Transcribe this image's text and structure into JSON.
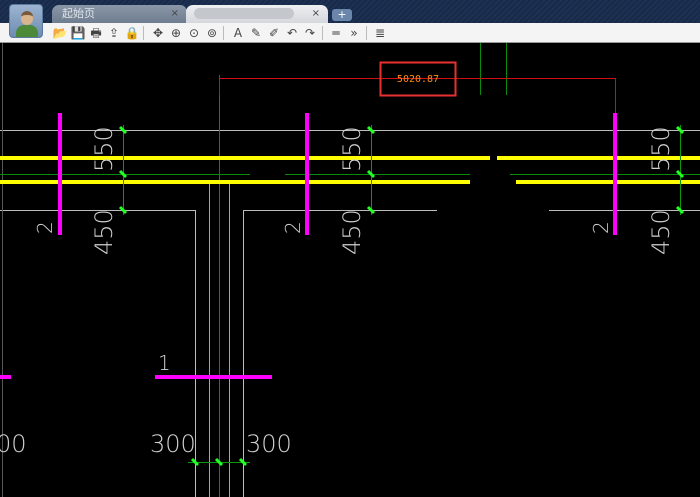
{
  "tabs": [
    {
      "label": "起始页",
      "close": "×"
    },
    {
      "label": "",
      "close": "×"
    }
  ],
  "new_tab": "+",
  "toolbar": {
    "icons": [
      "open-icon",
      "save-icon",
      "print-icon",
      "pdf-export-icon",
      "lock-icon",
      "pan-icon",
      "zoom-in-out-icon",
      "zoom-window-icon",
      "zoom-extents-icon",
      "text-icon",
      "pencil-icon",
      "markup-icon",
      "undo-icon",
      "redo-icon",
      "measure-length-icon",
      "measure-continuous-icon",
      "layers-icon"
    ],
    "glyphs": [
      "📂",
      "💾",
      "🖶",
      "⇪",
      "🔒",
      "✥",
      "⊕",
      "⊙",
      "⊚",
      "A",
      "✎",
      "✐",
      "↶",
      "↷",
      "═",
      "»",
      "≣"
    ]
  },
  "drawing": {
    "measurement": "5020.87",
    "dims": {
      "d550": "550",
      "d450": "450",
      "d300": "300",
      "d00": "00",
      "mark2": "2",
      "mark1": "1"
    }
  },
  "colors": {
    "measure_text": "#ff8c1a",
    "measure_box": "#e83030",
    "yellow": "#ffff00",
    "magenta": "#ff00ff",
    "green": "#00cc00",
    "tick": "#22ff22",
    "gray": "#bdbdbd"
  }
}
